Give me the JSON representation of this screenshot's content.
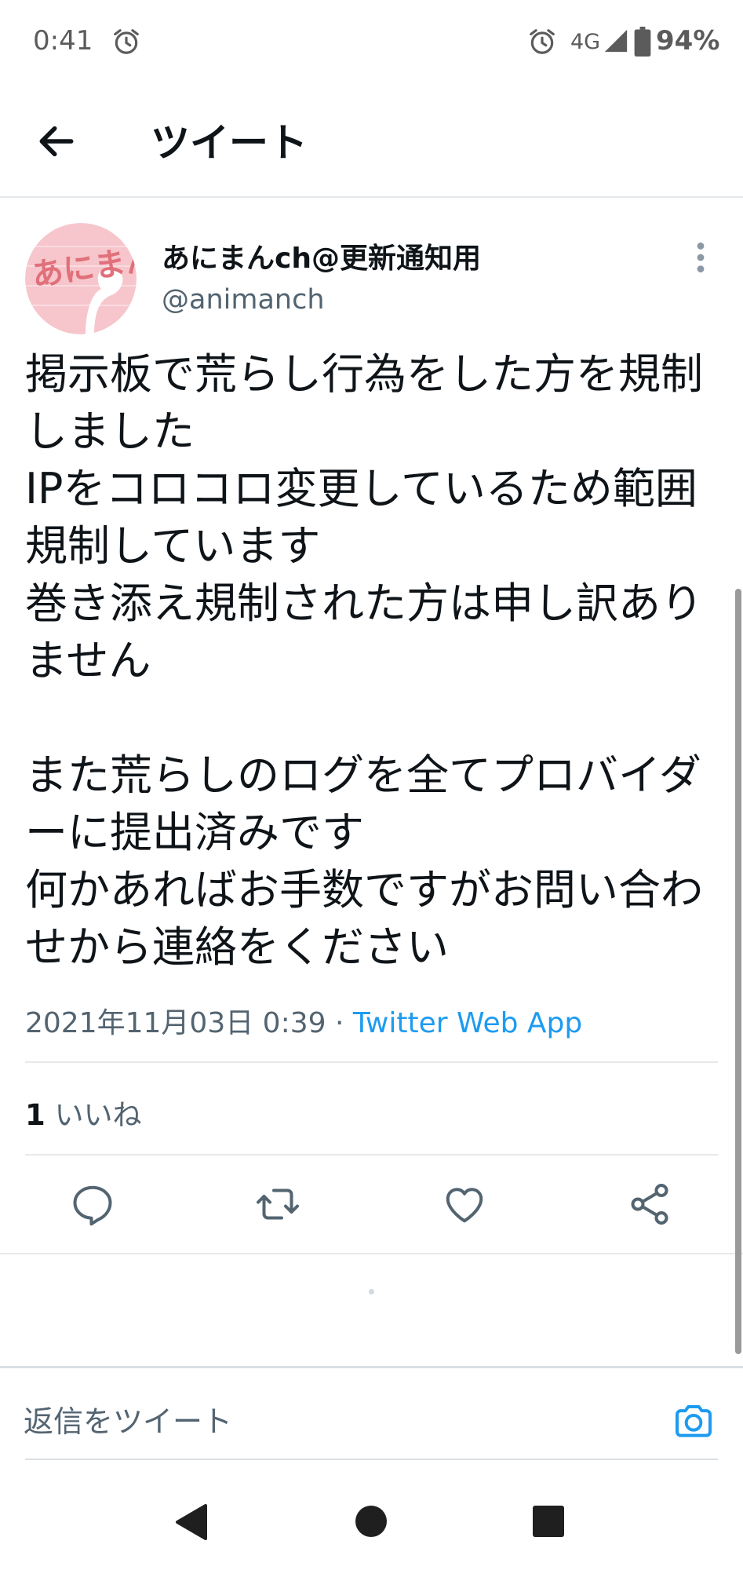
{
  "status_bar": {
    "time": "0:41",
    "network": "4G",
    "battery": "94%"
  },
  "header": {
    "title": "ツイート"
  },
  "tweet": {
    "author_name": "あにまんch@更新通知用",
    "author_handle": "@animanch",
    "text": "掲示板で荒らし行為をした方を規制しました\nIPをコロコロ変更しているため範囲規制しています\n巻き添え規制された方は申し訳ありません\n\nまた荒らしのログを全てプロバイダーに提出済みです\n何かあればお手数ですがお問い合わせから連絡をください",
    "timestamp": "2021年11月03日 0:39",
    "separator": " · ",
    "source": "Twitter Web App",
    "likes_count": "1",
    "likes_label": " いいね"
  },
  "actions": [
    "reply-icon",
    "retweet-icon",
    "like-icon",
    "share-icon"
  ],
  "reply_bar": {
    "placeholder": "返信をツイート"
  },
  "colors": {
    "accent": "#1d9bf0",
    "secondary_text": "#536471",
    "primary_text": "#0f1419",
    "avatar_bg": "#f6c6cc",
    "avatar_text": "#e0707a"
  }
}
